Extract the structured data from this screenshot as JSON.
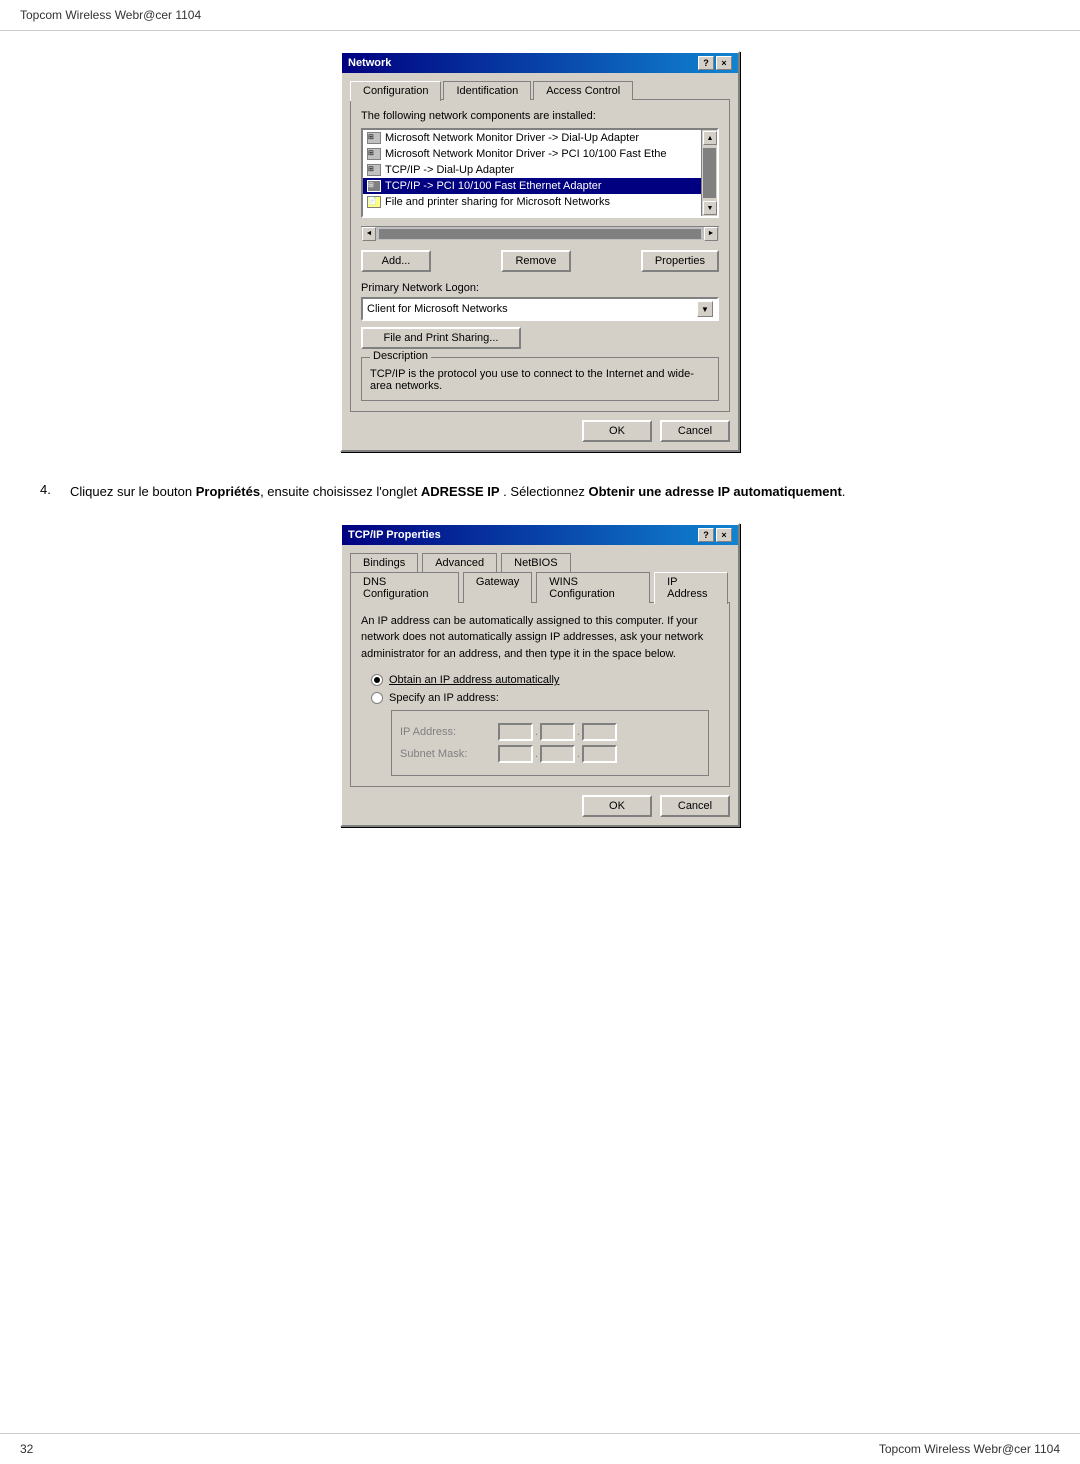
{
  "header": {
    "title": "Topcom Wireless Webr@cer 1104"
  },
  "footer": {
    "page_number": "32",
    "title": "Topcom Wireless Webr@cer 1104"
  },
  "network_dialog": {
    "title": "Network",
    "tabs": [
      {
        "label": "Configuration",
        "active": true
      },
      {
        "label": "Identification"
      },
      {
        "label": "Access Control"
      }
    ],
    "list_label": "The following network components are installed:",
    "list_items": [
      {
        "text": "Microsoft Network Monitor Driver -> Dial-Up Adapter",
        "type": "network",
        "selected": false
      },
      {
        "text": "Microsoft Network Monitor Driver -> PCI 10/100 Fast Ethe",
        "type": "network",
        "selected": false
      },
      {
        "text": "TCP/IP -> Dial-Up Adapter",
        "type": "network",
        "selected": false
      },
      {
        "text": "TCP/IP -> PCI 10/100 Fast Ethernet Adapter",
        "type": "network",
        "selected": true
      },
      {
        "text": "File and printer sharing for Microsoft Networks",
        "type": "file",
        "selected": false
      }
    ],
    "buttons": {
      "add": "Add...",
      "remove": "Remove",
      "properties": "Properties"
    },
    "primary_network_logon_label": "Primary Network Logon:",
    "primary_network_logon_value": "Client for Microsoft Networks",
    "file_print_sharing_btn": "File and Print Sharing...",
    "description_label": "Description",
    "description_text": "TCP/IP is the protocol you use to connect to the Internet and wide-area networks.",
    "ok_btn": "OK",
    "cancel_btn": "Cancel"
  },
  "instruction": {
    "number": "4.",
    "text_before_bold1": "Cliquez sur le bouton ",
    "bold1": "Propriétés",
    "text_between": ", ensuite choisissez l'onglet ",
    "bold2": "ADRESSE IP",
    "text_after": " . Sélectionnez ",
    "bold3": "Obtenir une adresse IP automatiquement",
    "text_end": "."
  },
  "tcpip_dialog": {
    "title": "TCP/IP Properties",
    "tabs_row1": [
      {
        "label": "Bindings"
      },
      {
        "label": "Advanced"
      },
      {
        "label": "NetBIOS"
      }
    ],
    "tabs_row2": [
      {
        "label": "DNS Configuration"
      },
      {
        "label": "Gateway"
      },
      {
        "label": "WINS Configuration"
      },
      {
        "label": "IP Address",
        "active": true
      }
    ],
    "description_text": "An IP address can be automatically assigned to this computer. If your network does not automatically assign IP addresses, ask your network administrator for an address, and then type it in the space below.",
    "radio_options": [
      {
        "label": "Obtain an IP address automatically",
        "selected": true
      },
      {
        "label": "Specify an IP address:",
        "selected": false
      }
    ],
    "ip_address_label": "IP Address:",
    "subnet_mask_label": "Subnet Mask:",
    "ok_btn": "OK",
    "cancel_btn": "Cancel"
  }
}
